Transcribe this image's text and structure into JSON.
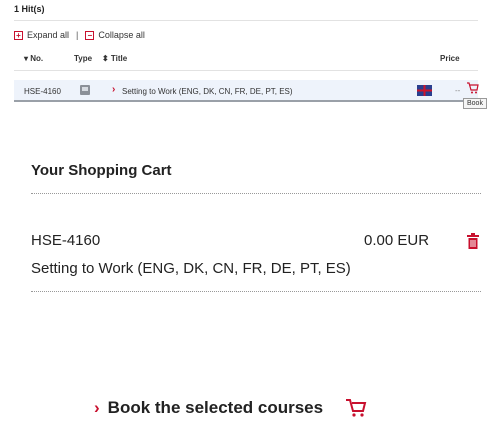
{
  "results": {
    "hits_label": "1 Hit(s)",
    "expand_all": "Expand all",
    "separator": "|",
    "collapse_all": "Collapse all",
    "columns": {
      "no": "▾ No.",
      "type": "Type",
      "title": "⬍ Title",
      "price": "Price"
    },
    "rows": [
      {
        "code": "HSE-4160",
        "title": "Setting to Work (ENG, DK, CN, FR, DE, PT, ES)",
        "price": "--",
        "tooltip": "Book"
      }
    ]
  },
  "cart": {
    "title": "Your Shopping Cart",
    "items": [
      {
        "code": "HSE-4160",
        "price": "0.00 EUR",
        "name": "Setting to Work (ENG, DK, CN, FR, DE, PT, ES)"
      }
    ],
    "book_button": "Book the selected courses"
  },
  "colors": {
    "accent": "#c8102e",
    "row_highlight": "#eef3fb"
  },
  "icons": {
    "expand": "expand-icon",
    "collapse": "collapse-icon",
    "type": "course-type-icon",
    "flag": "uk-flag-icon",
    "cart": "cart-icon",
    "trash": "trash-icon"
  }
}
